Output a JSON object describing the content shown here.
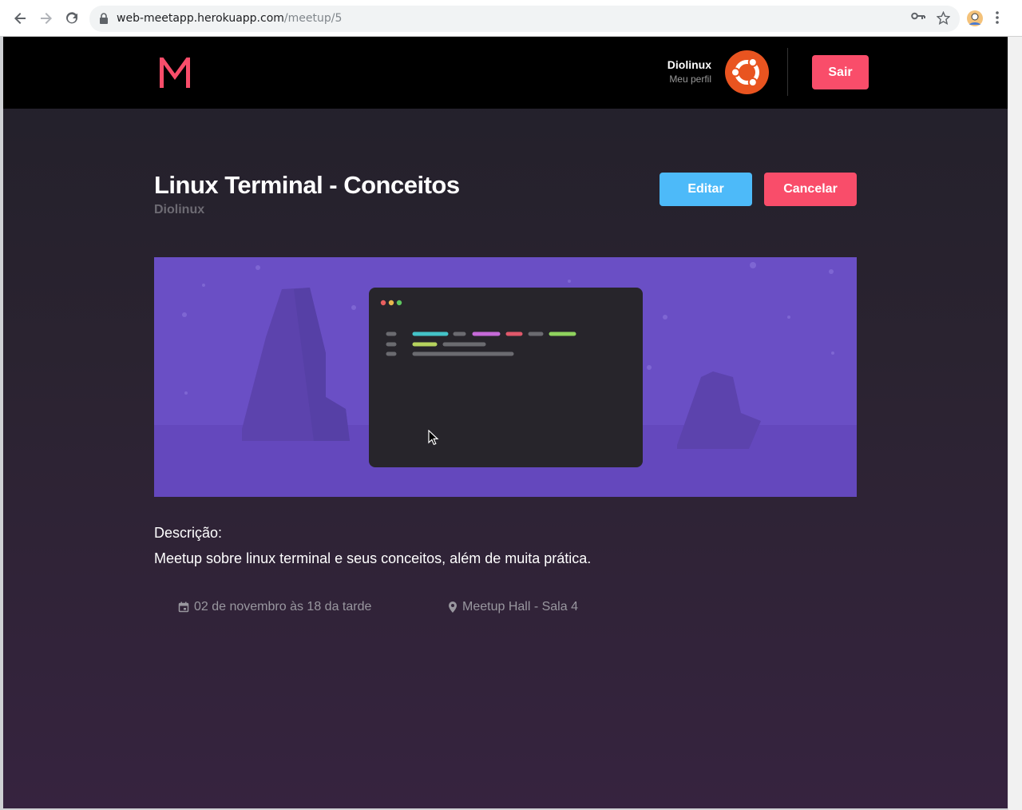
{
  "browser": {
    "url_host": "web-meetapp.herokuapp.com",
    "url_path": "/meetup/5"
  },
  "header": {
    "logo_icon": "meetapp-m-logo",
    "user_name": "Diolinux",
    "profile_link": "Meu perfil",
    "avatar_icon": "ubuntu-logo-avatar",
    "logout_label": "Sair"
  },
  "meetup": {
    "title": "Linux Terminal - Conceitos",
    "organizer": "Diolinux",
    "edit_label": "Editar",
    "cancel_label": "Cancelar",
    "banner_icon": "terminal-illustration-banner",
    "description_label": "Descrição:",
    "description": "Meetup sobre linux terminal e seus conceitos, além de muita prática.",
    "date": "02 de novembro às 18 da tarde",
    "location": "Meetup Hall - Sala 4"
  },
  "colors": {
    "accent_red": "#f94d6a",
    "accent_blue": "#4dbaf9",
    "header_bg": "#000000",
    "banner_purple": "#6a4fc5"
  }
}
